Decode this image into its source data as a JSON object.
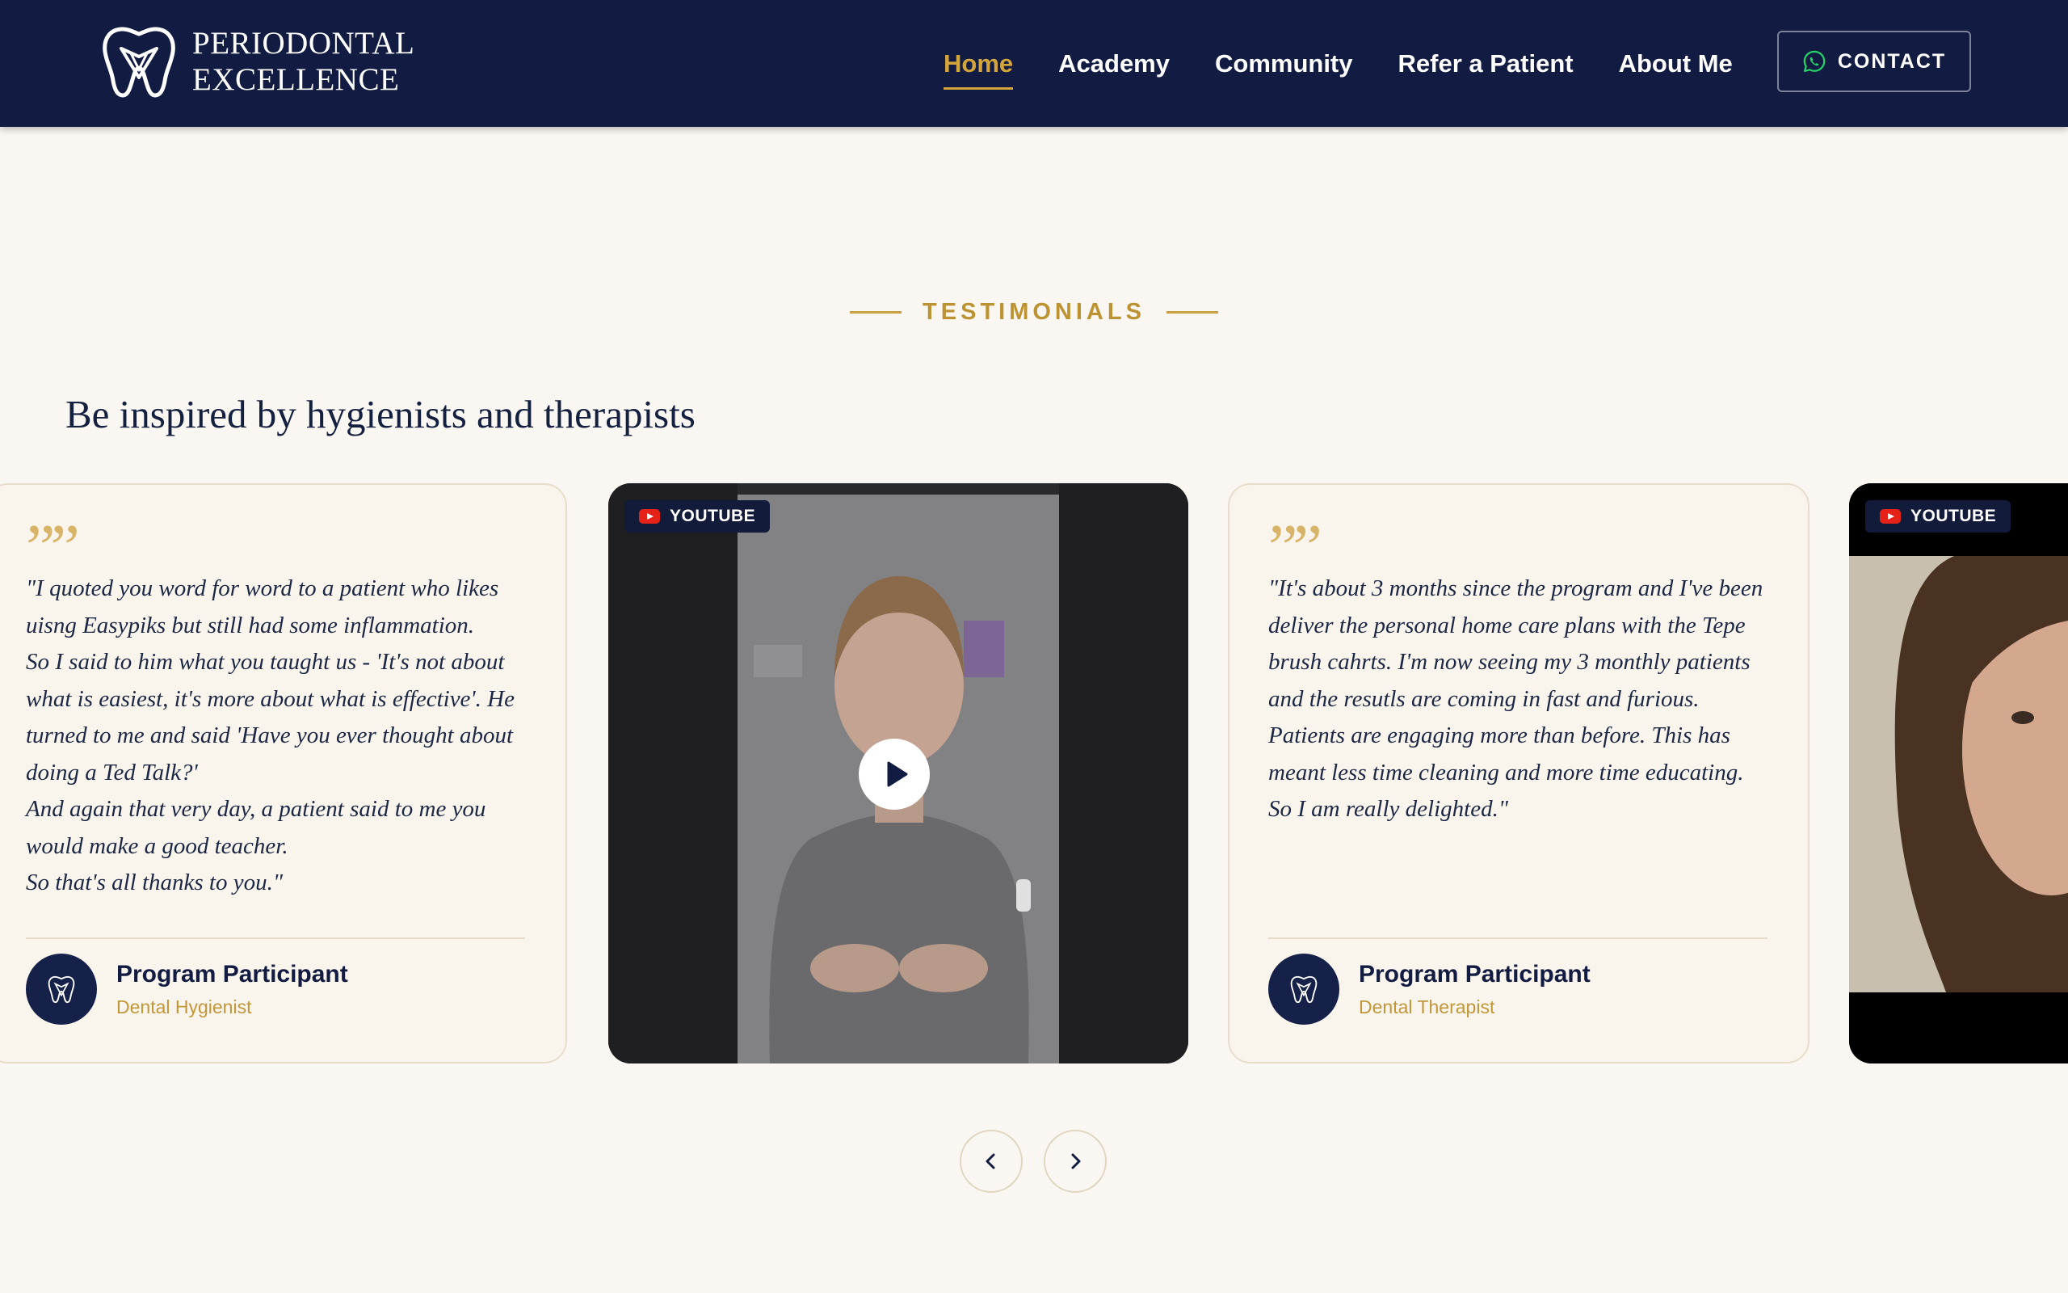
{
  "brand": {
    "line1": "PERIODONTAL",
    "line2": "EXCELLENCE",
    "logo_icon": "tooth-logo-icon"
  },
  "nav": {
    "items": [
      {
        "label": "Home",
        "active": true
      },
      {
        "label": "Academy",
        "active": false
      },
      {
        "label": "Community",
        "active": false
      },
      {
        "label": "Refer a Patient",
        "active": false
      },
      {
        "label": "About Me",
        "active": false
      }
    ],
    "contact_label": "CONTACT",
    "contact_icon": "whatsapp-icon"
  },
  "section": {
    "eyebrow": "TESTIMONIALS",
    "title": "Be inspired by hygienists and therapists"
  },
  "testimonials": [
    {
      "type": "text",
      "quote_lines": [
        "\"I quoted you word for word to a patient who likes uisng Easypiks but still had some inflammation.",
        "So I said to him what you taught us - 'It's not about what is easiest, it's more about what is effective'. He turned to me and said 'Have you ever thought about doing a Ted Talk?'",
        "And again that very day, a patient said to me you would make a good teacher.",
        "So that's all thanks to you.\""
      ],
      "author_name": "Program Participant",
      "author_role": "Dental Hygienist"
    },
    {
      "type": "video",
      "badge": "YOUTUBE"
    },
    {
      "type": "text",
      "quote_lines": [
        "\"It's about 3 months since the program and I've been deliver the personal home care plans with the Tepe brush cahrts. I'm now seeing my 3 monthly patients and the resutls are coming in fast and furious. Patients are engaging more than before. This has meant less time cleaning and more time educating.",
        "So I am really delighted.\""
      ],
      "author_name": "Program Participant",
      "author_role": "Dental Therapist"
    },
    {
      "type": "video",
      "badge": "YOUTUBE"
    }
  ],
  "controls": {
    "prev_icon": "chevron-left-icon",
    "next_icon": "chevron-right-icon"
  },
  "colors": {
    "navy": "#121c42",
    "gold": "#d4a53b",
    "background": "#faf7f2",
    "youtube_red": "#e62117"
  }
}
